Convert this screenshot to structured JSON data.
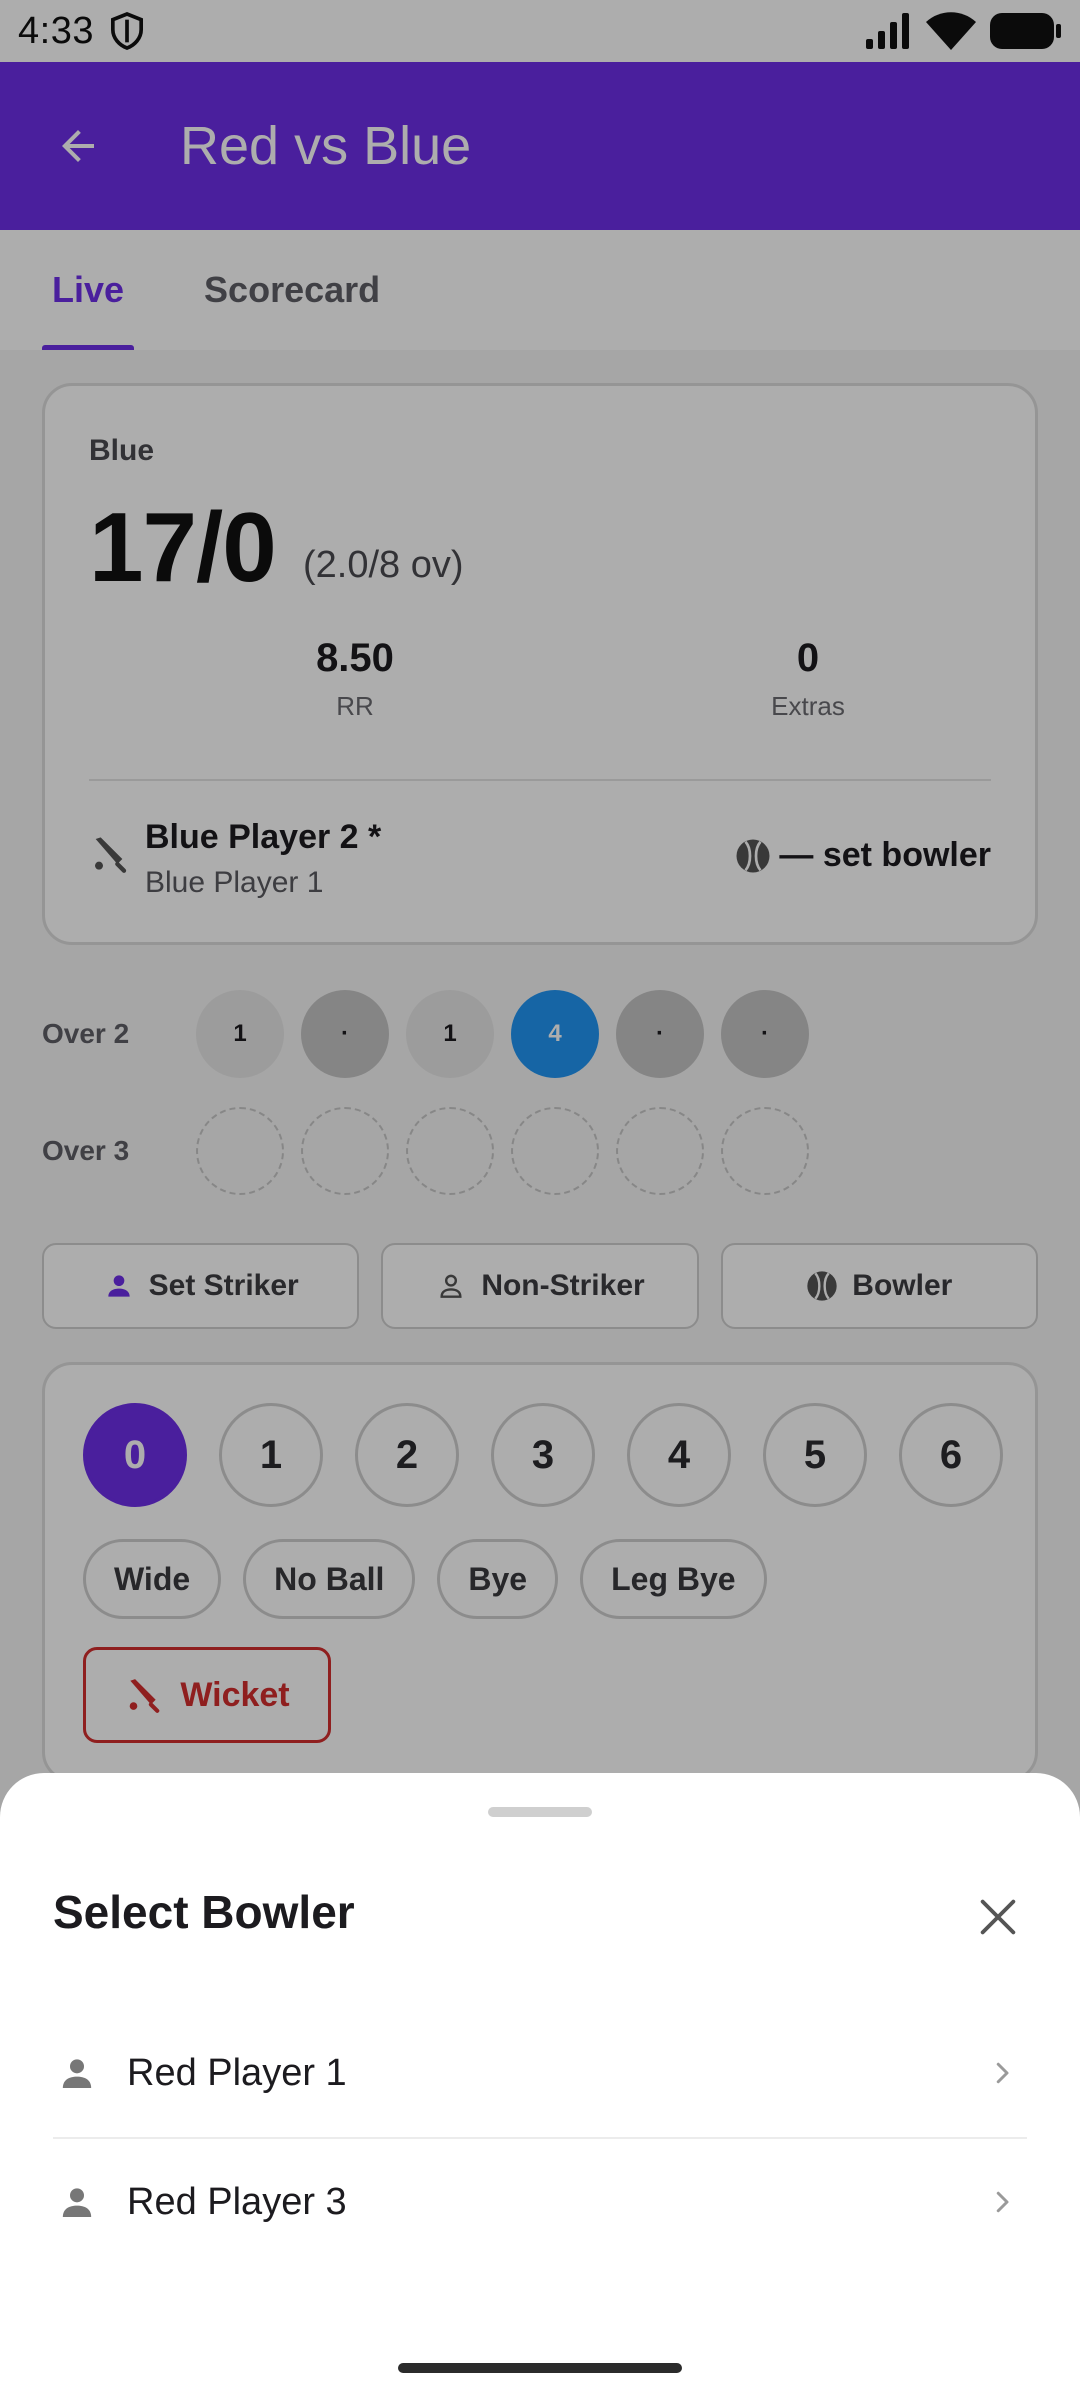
{
  "status_bar": {
    "time": "4:33"
  },
  "app_bar": {
    "title": "Red vs Blue"
  },
  "tabs": [
    {
      "label": "Live",
      "active": true
    },
    {
      "label": "Scorecard",
      "active": false
    }
  ],
  "score_card": {
    "team": "Blue",
    "score": "17/0",
    "overs": "(2.0/8 ov)",
    "run_rate": {
      "value": "8.50",
      "label": "RR"
    },
    "extras": {
      "value": "0",
      "label": "Extras"
    },
    "striker": "Blue Player 2 *",
    "non_striker": "Blue Player 1",
    "bowler_prompt": "— set bowler"
  },
  "overs": [
    {
      "label": "Over 2",
      "balls": [
        "1",
        "·",
        "1",
        "4",
        "·",
        "·"
      ]
    },
    {
      "label": "Over 3",
      "balls": [
        "",
        "",
        "",
        "",
        "",
        ""
      ]
    }
  ],
  "role_buttons": {
    "striker": "Set Striker",
    "non_striker": "Non-Striker",
    "bowler": "Bowler"
  },
  "scoring": {
    "runs": [
      "0",
      "1",
      "2",
      "3",
      "4",
      "5",
      "6"
    ],
    "selected_run": "0",
    "extras": [
      "Wide",
      "No Ball",
      "Bye",
      "Leg Bye"
    ],
    "wicket": "Wicket"
  },
  "sheet": {
    "title": "Select Bowler",
    "bowlers": [
      "Red Player 1",
      "Red Player 3"
    ]
  },
  "colors": {
    "primary": "#6d2ee8",
    "four": "#2196f3",
    "wicket": "#d32f2f"
  },
  "icons": {
    "back": "arrow-left-icon",
    "close": "close-icon",
    "person": "person-icon",
    "bat": "cricket-bat-icon",
    "ball": "cricket-ball-icon",
    "chevron": "chevron-right-icon"
  }
}
